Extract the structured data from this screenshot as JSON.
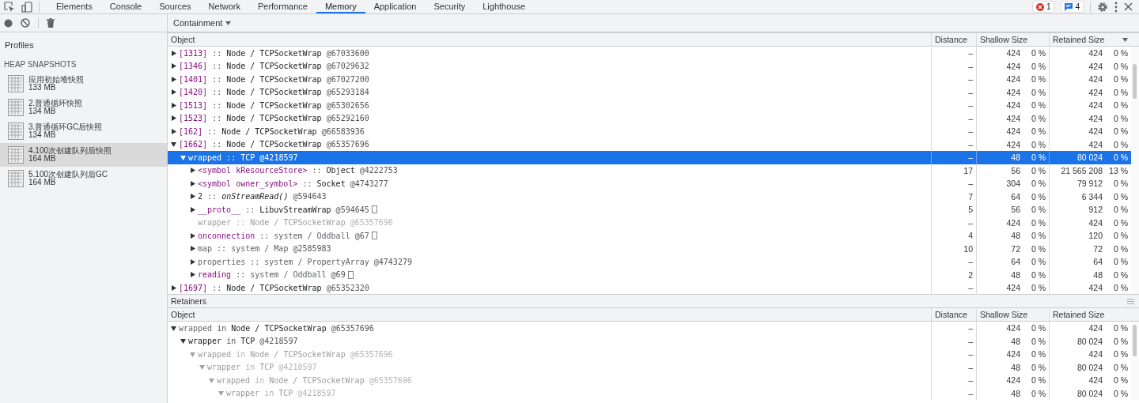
{
  "tabs": [
    {
      "label": "Elements",
      "selected": false
    },
    {
      "label": "Console",
      "selected": false
    },
    {
      "label": "Sources",
      "selected": false
    },
    {
      "label": "Network",
      "selected": false
    },
    {
      "label": "Performance",
      "selected": false
    },
    {
      "label": "Memory",
      "selected": true
    },
    {
      "label": "Application",
      "selected": false
    },
    {
      "label": "Security",
      "selected": false
    },
    {
      "label": "Lighthouse",
      "selected": false
    }
  ],
  "badges": {
    "errors": "1",
    "messages": "4"
  },
  "sidebar": {
    "title": "Profiles",
    "section": "HEAP SNAPSHOTS",
    "snapshots": [
      {
        "name": "应用初始堆快照",
        "size": "133 MB",
        "selected": false
      },
      {
        "name": "2.普通循环快照",
        "size": "134 MB",
        "selected": false
      },
      {
        "name": "3.普通循环GC后快照",
        "size": "134 MB",
        "selected": false
      },
      {
        "name": "4.100次创建队列后快照",
        "size": "164 MB",
        "selected": true
      },
      {
        "name": "5.100次创建队列后GC",
        "size": "164 MB",
        "selected": false
      }
    ]
  },
  "view_select": "Containment",
  "objects": {
    "columns": [
      {
        "label": "Object",
        "sorted": false
      },
      {
        "label": "Distance",
        "sorted": false
      },
      {
        "label": "Shallow Size",
        "sorted": false
      },
      {
        "label": "Retained Size",
        "sorted": true
      }
    ],
    "rows": [
      {
        "label": "[1313]",
        "kind": "element",
        "sep": "::",
        "detail": "Node / TCPSocketWrap",
        "detail_dim": false,
        "detail_italic": false,
        "id": "@67033600",
        "boxed": false,
        "dim": false,
        "expanded": false,
        "selected": false,
        "distance": "–",
        "shallow": "424",
        "shallow_pct": "0 %",
        "retained": "424",
        "retained_pct": "0 %"
      },
      {
        "label": "[1346]",
        "kind": "element",
        "sep": "::",
        "detail": "Node / TCPSocketWrap",
        "detail_dim": false,
        "detail_italic": false,
        "id": "@67029632",
        "boxed": false,
        "dim": false,
        "expanded": false,
        "selected": false,
        "distance": "–",
        "shallow": "424",
        "shallow_pct": "0 %",
        "retained": "424",
        "retained_pct": "0 %"
      },
      {
        "label": "[1401]",
        "kind": "element",
        "sep": "::",
        "detail": "Node / TCPSocketWrap",
        "detail_dim": false,
        "detail_italic": false,
        "id": "@67027200",
        "boxed": false,
        "dim": false,
        "expanded": false,
        "selected": false,
        "distance": "–",
        "shallow": "424",
        "shallow_pct": "0 %",
        "retained": "424",
        "retained_pct": "0 %"
      },
      {
        "label": "[1420]",
        "kind": "element",
        "sep": "::",
        "detail": "Node / TCPSocketWrap",
        "detail_dim": false,
        "detail_italic": false,
        "id": "@65293184",
        "boxed": false,
        "dim": false,
        "expanded": false,
        "selected": false,
        "distance": "–",
        "shallow": "424",
        "shallow_pct": "0 %",
        "retained": "424",
        "retained_pct": "0 %"
      },
      {
        "label": "[1513]",
        "kind": "element",
        "sep": "::",
        "detail": "Node / TCPSocketWrap",
        "detail_dim": false,
        "detail_italic": false,
        "id": "@65302656",
        "boxed": false,
        "dim": false,
        "expanded": false,
        "selected": false,
        "distance": "–",
        "shallow": "424",
        "shallow_pct": "0 %",
        "retained": "424",
        "retained_pct": "0 %"
      },
      {
        "label": "[1523]",
        "kind": "element",
        "sep": "::",
        "detail": "Node / TCPSocketWrap",
        "detail_dim": false,
        "detail_italic": false,
        "id": "@65292160",
        "boxed": false,
        "dim": false,
        "expanded": false,
        "selected": false,
        "distance": "–",
        "shallow": "424",
        "shallow_pct": "0 %",
        "retained": "424",
        "retained_pct": "0 %"
      },
      {
        "label": "[162]",
        "kind": "element",
        "sep": "::",
        "detail": "Node / TCPSocketWrap",
        "detail_dim": false,
        "detail_italic": false,
        "id": "@66583936",
        "boxed": false,
        "dim": false,
        "expanded": false,
        "selected": false,
        "distance": "–",
        "shallow": "424",
        "shallow_pct": "0 %",
        "retained": "424",
        "retained_pct": "0 %"
      },
      {
        "label": "[1662]",
        "kind": "element",
        "sep": "::",
        "detail": "Node / TCPSocketWrap",
        "detail_dim": false,
        "detail_italic": false,
        "id": "@65357696",
        "boxed": false,
        "dim": false,
        "expanded": true,
        "selected": false,
        "distance": "–",
        "shallow": "424",
        "shallow_pct": "0 %",
        "retained": "424",
        "retained_pct": "0 %",
        "children": [
          {
            "label": "wrapped",
            "kind": "property",
            "sep": "::",
            "detail": "TCP",
            "detail_dim": false,
            "detail_italic": false,
            "id": "@4218597",
            "boxed": false,
            "dim": false,
            "expanded": true,
            "selected": true,
            "distance": "–",
            "shallow": "48",
            "shallow_pct": "0 %",
            "retained": "80 024",
            "retained_pct": "0 %",
            "children": [
              {
                "label": "<symbol kResourceStore>",
                "kind": "property",
                "sep": "::",
                "detail": "Object",
                "detail_dim": false,
                "detail_italic": false,
                "id": "@4222753",
                "boxed": false,
                "dim": false,
                "expanded": false,
                "selected": false,
                "distance": "17",
                "shallow": "56",
                "shallow_pct": "0 %",
                "retained": "21 565 208",
                "retained_pct": "13 %"
              },
              {
                "label": "<symbol owner_symbol>",
                "kind": "property",
                "sep": "::",
                "detail": "Socket",
                "detail_dim": false,
                "detail_italic": false,
                "id": "@4743277",
                "boxed": false,
                "dim": false,
                "expanded": false,
                "selected": false,
                "distance": "–",
                "shallow": "304",
                "shallow_pct": "0 %",
                "retained": "79 912",
                "retained_pct": "0 %"
              },
              {
                "label": "2",
                "kind": "plain",
                "sep": "::",
                "detail": "onStreamRead()",
                "detail_dim": false,
                "detail_italic": true,
                "id": "@594643",
                "boxed": false,
                "dim": false,
                "expanded": false,
                "selected": false,
                "distance": "7",
                "shallow": "64",
                "shallow_pct": "0 %",
                "retained": "6 344",
                "retained_pct": "0 %"
              },
              {
                "label": "__proto__",
                "kind": "property",
                "sep": "::",
                "detail": "LibuvStreamWrap",
                "detail_dim": false,
                "detail_italic": false,
                "id": "@594645",
                "boxed": true,
                "dim": false,
                "expanded": false,
                "selected": false,
                "distance": "5",
                "shallow": "56",
                "shallow_pct": "0 %",
                "retained": "912",
                "retained_pct": "0 %"
              },
              {
                "label": "wrapper",
                "kind": "plain",
                "sep": "::",
                "detail": "Node / TCPSocketWrap",
                "detail_dim": false,
                "detail_italic": false,
                "id": "@65357696",
                "boxed": false,
                "dim": true,
                "selected": false,
                "distance": "–",
                "shallow": "424",
                "shallow_pct": "0 %",
                "retained": "424",
                "retained_pct": "0 %"
              },
              {
                "label": "onconnection",
                "kind": "property",
                "sep": "::",
                "detail": "system / Oddball",
                "detail_dim": true,
                "detail_italic": false,
                "id": "@67",
                "boxed": true,
                "dim": false,
                "expanded": false,
                "selected": false,
                "distance": "4",
                "shallow": "48",
                "shallow_pct": "0 %",
                "retained": "120",
                "retained_pct": "0 %"
              },
              {
                "label": "map",
                "kind": "internal",
                "sep": "::",
                "detail": "system / Map",
                "detail_dim": true,
                "detail_italic": false,
                "id": "@2585983",
                "boxed": false,
                "dim": false,
                "expanded": false,
                "selected": false,
                "distance": "10",
                "shallow": "72",
                "shallow_pct": "0 %",
                "retained": "72",
                "retained_pct": "0 %"
              },
              {
                "label": "properties",
                "kind": "internal",
                "sep": "::",
                "detail": "system / PropertyArray",
                "detail_dim": true,
                "detail_italic": false,
                "id": "@4743279",
                "boxed": false,
                "dim": false,
                "expanded": false,
                "selected": false,
                "distance": "–",
                "shallow": "64",
                "shallow_pct": "0 %",
                "retained": "64",
                "retained_pct": "0 %"
              },
              {
                "label": "reading",
                "kind": "property",
                "sep": "::",
                "detail": "system / Oddball",
                "detail_dim": true,
                "detail_italic": false,
                "id": "@69",
                "boxed": true,
                "dim": false,
                "expanded": false,
                "selected": false,
                "distance": "2",
                "shallow": "48",
                "shallow_pct": "0 %",
                "retained": "48",
                "retained_pct": "0 %"
              }
            ]
          }
        ]
      },
      {
        "label": "[1697]",
        "kind": "element",
        "sep": "::",
        "detail": "Node / TCPSocketWrap",
        "detail_dim": false,
        "detail_italic": false,
        "id": "@65352320",
        "boxed": false,
        "dim": false,
        "expanded": false,
        "selected": false,
        "distance": "–",
        "shallow": "424",
        "shallow_pct": "0 %",
        "retained": "424",
        "retained_pct": "0 %"
      }
    ]
  },
  "retainers": {
    "title": "Retainers",
    "columns": [
      {
        "label": "Object",
        "sorted": false
      },
      {
        "label": "Distance",
        "sorted": false
      },
      {
        "label": "Shallow Size",
        "sorted": false
      },
      {
        "label": "Retained Size",
        "sorted": false
      }
    ],
    "rows": [
      {
        "label": "wrapped",
        "kind": "internal",
        "sep": "in",
        "detail": "Node / TCPSocketWrap",
        "detail_dim": false,
        "detail_italic": false,
        "id": "@65357696",
        "boxed": false,
        "dim": false,
        "expanded": true,
        "selected": false,
        "distance": "–",
        "shallow": "424",
        "shallow_pct": "0 %",
        "retained": "424",
        "retained_pct": "0 %",
        "children": [
          {
            "label": "wrapper",
            "kind": "plain",
            "sep": "in",
            "detail": "TCP",
            "detail_dim": false,
            "detail_italic": false,
            "id": "@4218597",
            "boxed": false,
            "dim": false,
            "expanded": true,
            "selected": false,
            "distance": "–",
            "shallow": "48",
            "shallow_pct": "0 %",
            "retained": "80 024",
            "retained_pct": "0 %",
            "children": [
              {
                "label": "wrapped",
                "kind": "plain",
                "sep": "in",
                "detail": "Node / TCPSocketWrap",
                "detail_dim": false,
                "detail_italic": false,
                "id": "@65357696",
                "boxed": false,
                "dim": true,
                "expanded": true,
                "selected": false,
                "distance": "–",
                "shallow": "424",
                "shallow_pct": "0 %",
                "retained": "424",
                "retained_pct": "0 %",
                "children": [
                  {
                    "label": "wrapper",
                    "kind": "plain",
                    "sep": "in",
                    "detail": "TCP",
                    "detail_dim": false,
                    "detail_italic": false,
                    "id": "@4218597",
                    "boxed": false,
                    "dim": true,
                    "expanded": true,
                    "selected": false,
                    "distance": "–",
                    "shallow": "48",
                    "shallow_pct": "0 %",
                    "retained": "80 024",
                    "retained_pct": "0 %",
                    "children": [
                      {
                        "label": "wrapped",
                        "kind": "plain",
                        "sep": "in",
                        "detail": "Node / TCPSocketWrap",
                        "detail_dim": false,
                        "detail_italic": false,
                        "id": "@65357696",
                        "boxed": false,
                        "dim": true,
                        "expanded": true,
                        "selected": false,
                        "distance": "–",
                        "shallow": "424",
                        "shallow_pct": "0 %",
                        "retained": "424",
                        "retained_pct": "0 %",
                        "children": [
                          {
                            "label": "wrapper",
                            "kind": "plain",
                            "sep": "in",
                            "detail": "TCP",
                            "detail_dim": false,
                            "detail_italic": false,
                            "id": "@4218597",
                            "boxed": false,
                            "dim": true,
                            "expanded": true,
                            "selected": false,
                            "distance": "–",
                            "shallow": "48",
                            "shallow_pct": "0 %",
                            "retained": "80 024",
                            "retained_pct": "0 %"
                          }
                        ]
                      }
                    ]
                  }
                ]
              }
            ]
          }
        ]
      }
    ]
  }
}
